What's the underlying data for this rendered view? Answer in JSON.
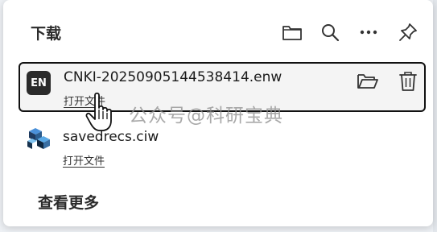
{
  "panel": {
    "title": "下载",
    "header_icons": [
      "folder-icon",
      "search-icon",
      "more-options-icon",
      "pin-icon"
    ]
  },
  "downloads": [
    {
      "icon_text": "EN",
      "filename": "CNKI-20250905144538414.enw",
      "open_label": "打开文件",
      "actions": [
        "open-folder-icon",
        "delete-icon"
      ]
    },
    {
      "filename": "savedrecs.ciw",
      "open_label": "打开文件"
    }
  ],
  "footer": {
    "more_label": "查看更多"
  },
  "watermark": "公众号@科研宝典",
  "colors": {
    "selected_border": "#111111",
    "selected_bg": "#f4f4f4"
  }
}
